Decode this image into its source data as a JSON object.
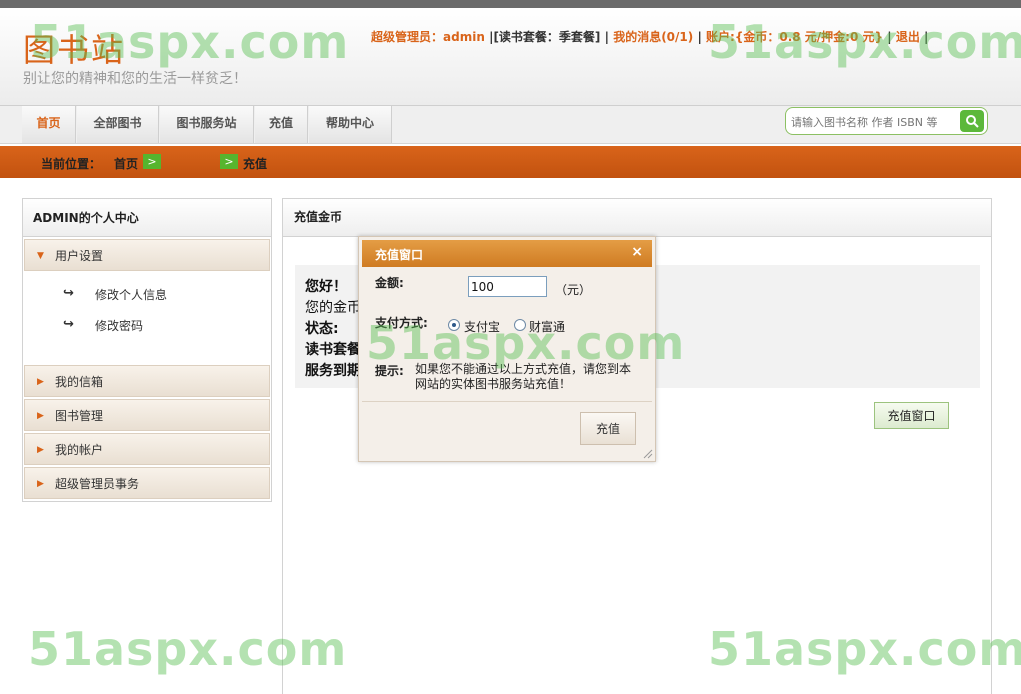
{
  "header": {
    "logo": "图书站",
    "slogan": "别让您的精神和您的生活一样贫乏！",
    "user_role": "超级管理员：",
    "username": "admin",
    "plan": "|[读书套餐：季套餐]",
    "sep1": "|",
    "messages": "我的消息(0/1)",
    "sep2": "|",
    "account": "账户:{金币：0.8 元/押金:0 元}",
    "sep3": "|",
    "logout": "退出",
    "sep4": "|"
  },
  "nav": {
    "items": [
      "首页",
      "全部图书",
      "图书服务站",
      "充值",
      "帮助中心"
    ]
  },
  "search": {
    "placeholder": "请输入图书名称 作者 ISBN 等"
  },
  "breadcrumb": {
    "label": "当前位置：",
    "home": "首页",
    "arrow": ">",
    "current": "充值"
  },
  "sidebar": {
    "title": "ADMIN的个人中心",
    "groups": [
      {
        "label": "用户设置",
        "items": [
          "修改个人信息",
          "修改密码"
        ]
      },
      {
        "label": "我的信箱"
      },
      {
        "label": "图书管理"
      },
      {
        "label": "我的帐户"
      },
      {
        "label": "超级管理员事务"
      }
    ]
  },
  "main": {
    "title": "充值金币",
    "info": [
      "您好！",
      "您的金币",
      "状态:",
      "读书套餐",
      "服务到期"
    ],
    "open_dialog_button": "充值窗口"
  },
  "dialog": {
    "title": "充值窗口",
    "close_glyph": "×",
    "amount_label": "金额:",
    "amount_value": "100",
    "unit": "（元）",
    "payment_label": "支付方式:",
    "payment_options": [
      "支付宝",
      "财富通"
    ],
    "selected_payment": "支付宝",
    "tip_label": "提示:",
    "tip_text": "如果您不能通过以上方式充值，请您到本网站的实体图书服务站充值！",
    "submit_button": "充值"
  },
  "watermark": {
    "text": "51aspx.com"
  },
  "colors": {
    "brand_orange": "#d9641a",
    "accent_green": "#5cb83a"
  }
}
